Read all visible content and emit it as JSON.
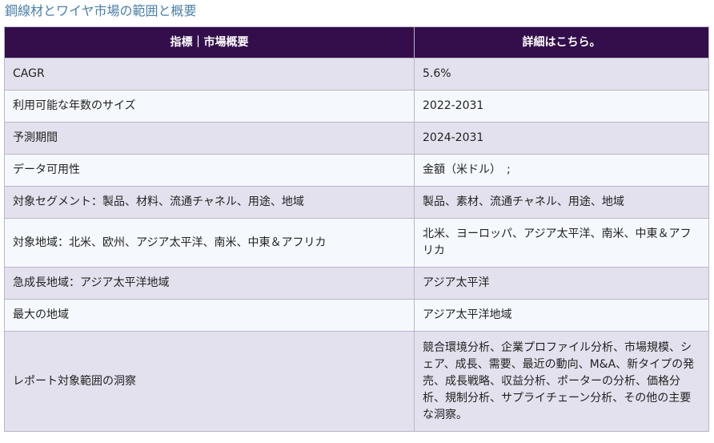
{
  "title": "鋼線材とワイヤ市場の範囲と概要",
  "table": {
    "headers": [
      "指標｜市場概要",
      "詳細はこちら。"
    ],
    "rows": [
      {
        "metric": "CAGR",
        "detail": "5.6%"
      },
      {
        "metric": "利用可能な年数のサイズ",
        "detail": "2022-2031"
      },
      {
        "metric": "予測期間",
        "detail": "2024-2031"
      },
      {
        "metric": "データ可用性",
        "detail": "金額（米ドル）　;"
      },
      {
        "metric": "対象セグメント：製品、材料、流通チャネル、用途、地域",
        "detail": "製品、素材、流通チャネル、用途、地域"
      },
      {
        "metric": "対象地域：北米、欧州、アジア太平洋、南米、中東＆アフリカ",
        "detail": "北米、ヨーロッパ、アジア太平洋、南米、中東＆アフリカ"
      },
      {
        "metric": "急成長地域：アジア太平洋地域",
        "detail": "アジア太平洋"
      },
      {
        "metric": "最大の地域",
        "detail": "アジア太平洋地域"
      },
      {
        "metric": "レポート対象範囲の洞察",
        "detail": "競合環境分析、企業プロファイル分析、市場規模、シェア、成長、需要、最近の動向、M&A、新タイプの発売、成長戦略、収益分析、ポーターの分析、価格分析、規制分析、サプライチェーン分析、その他の主要な洞察。"
      }
    ]
  }
}
